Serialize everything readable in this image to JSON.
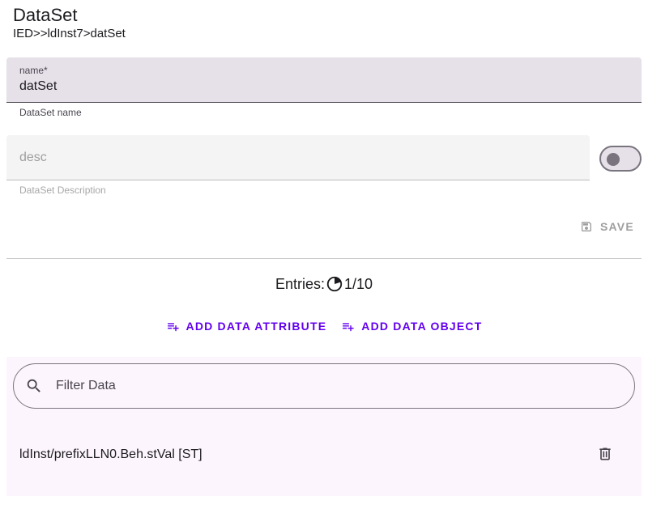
{
  "header": {
    "title": "DataSet",
    "path": "IED>>ldInst7>datSet"
  },
  "name_field": {
    "label": "name*",
    "value": "datSet",
    "helper": "DataSet name"
  },
  "desc_field": {
    "placeholder": "desc",
    "helper": "DataSet Description",
    "toggle_on": false
  },
  "save_button": {
    "label": "SAVE",
    "icon": "save-icon"
  },
  "entries": {
    "label": "Entries:",
    "count": "1/10",
    "icon": "progress-pie-icon"
  },
  "actions": {
    "add_data_attribute": "ADD DATA ATTRIBUTE",
    "add_data_object": "ADD DATA OBJECT",
    "icon": "playlist-add-icon"
  },
  "filter": {
    "placeholder": "Filter Data",
    "icon": "search-icon"
  },
  "list": {
    "items": [
      {
        "label": "ldInst/prefixLLN0.Beh.stVal [ST]",
        "action_icon": "delete-icon"
      }
    ]
  },
  "colors": {
    "accent": "#6200ee",
    "field_bg": "#e6e0e9",
    "panel_bg": "#fdf5fd"
  }
}
